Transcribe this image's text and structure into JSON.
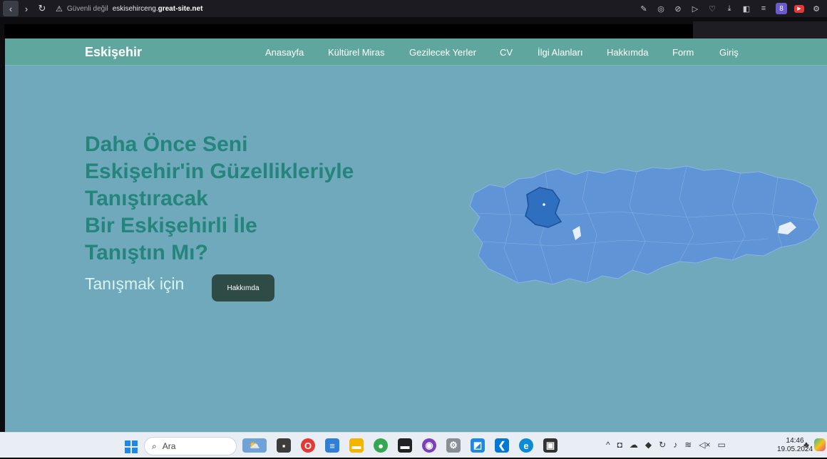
{
  "browser": {
    "security_label": "Güvenli değil",
    "url_prefix": "eskisehirceng.",
    "url_domain": "great-site.net"
  },
  "site": {
    "brand": "Eskişehir",
    "menu": [
      "Anasayfa",
      "Kültürel Miras",
      "Gezilecek Yerler",
      "CV",
      "İlgi Alanları",
      "Hakkımda",
      "Form",
      "Giriş"
    ],
    "hero_lines": [
      "Daha Önce Seni",
      "Eskişehir'in Güzellikleriyle",
      "Tanıştıracak",
      "Bir Eskişehirli İle",
      "Tanıştın Mı?"
    ],
    "intro_text": "Tanışmak için",
    "cta_label": "Hakkımda",
    "colors": {
      "nav": "#5fa79e",
      "background": "#6fa9bb",
      "heading": "#24857c",
      "button": "#2e4b46",
      "map": "#5f95d6",
      "highlight": "#2f6fc0"
    }
  },
  "taskbar": {
    "search_placeholder": "Ara",
    "time": "14:46",
    "date": "19.05.2024"
  }
}
